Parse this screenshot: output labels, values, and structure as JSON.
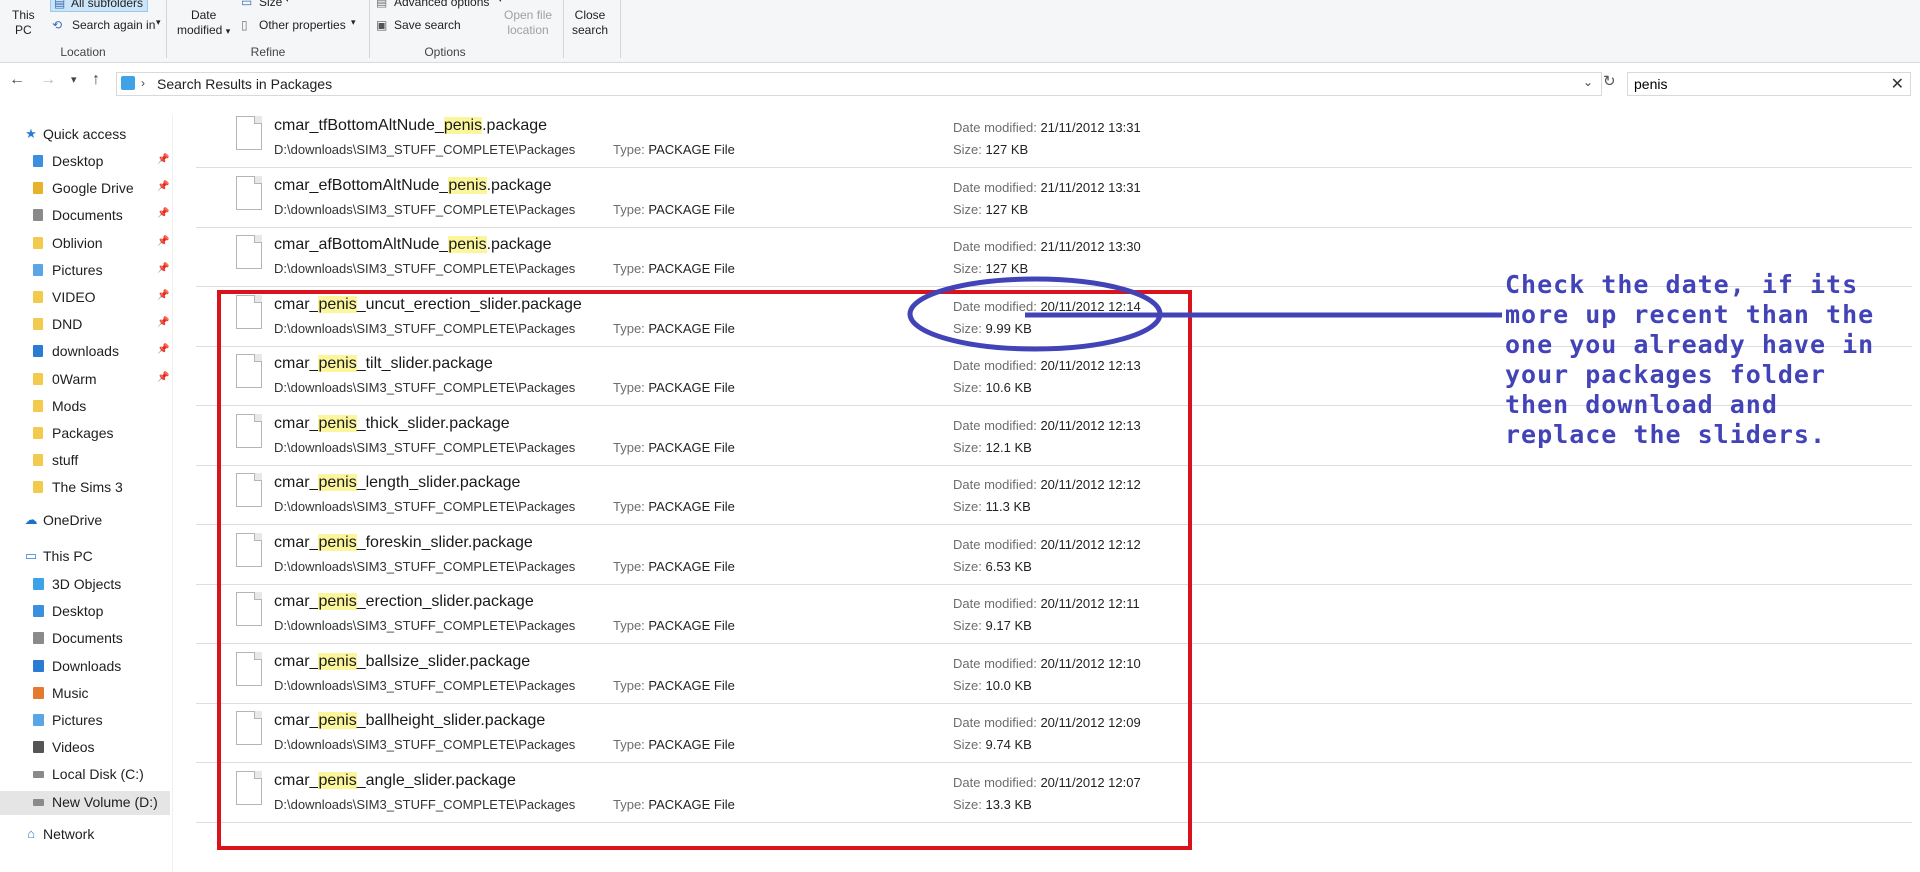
{
  "ribbon": {
    "location": {
      "this_pc_line1": "This",
      "this_pc_line2": "PC",
      "all_subfolders": "All subfolders",
      "search_again_in": "Search again in",
      "group_label": "Location"
    },
    "refine": {
      "date_modified_line1": "Date",
      "date_modified_line2": "modified",
      "size": "Size",
      "other_properties": "Other properties",
      "group_label": "Refine"
    },
    "options": {
      "advanced_options": "Advanced options",
      "save_search": "Save search",
      "open_file_location_line1": "Open file",
      "open_file_location_line2": "location",
      "group_label": "Options"
    },
    "close_search_line1": "Close",
    "close_search_line2": "search"
  },
  "address_bar": {
    "path": "Search Results in Packages",
    "search_value": "penis"
  },
  "sidebar": {
    "quick_access": "Quick access",
    "quick_items": [
      {
        "label": "Desktop",
        "pinned": true
      },
      {
        "label": "Google Drive",
        "pinned": true
      },
      {
        "label": "Documents",
        "pinned": true
      },
      {
        "label": "Oblivion",
        "pinned": true
      },
      {
        "label": "Pictures",
        "pinned": true
      },
      {
        "label": "VIDEO",
        "pinned": true
      },
      {
        "label": "DND",
        "pinned": true
      },
      {
        "label": "downloads",
        "pinned": true
      },
      {
        "label": "0Warm",
        "pinned": true
      },
      {
        "label": "Mods",
        "pinned": false
      },
      {
        "label": "Packages",
        "pinned": false
      },
      {
        "label": "stuff",
        "pinned": false
      },
      {
        "label": "The Sims 3",
        "pinned": false
      }
    ],
    "onedrive": "OneDrive",
    "this_pc": "This PC",
    "pc_items": [
      {
        "label": "3D Objects"
      },
      {
        "label": "Desktop"
      },
      {
        "label": "Documents"
      },
      {
        "label": "Downloads"
      },
      {
        "label": "Music"
      },
      {
        "label": "Pictures"
      },
      {
        "label": "Videos"
      },
      {
        "label": "Local Disk (C:)"
      },
      {
        "label": "New Volume (D:)"
      }
    ],
    "network": "Network"
  },
  "labels": {
    "type_key": "Type:",
    "date_key": "Date modified:",
    "size_key": "Size:"
  },
  "files": [
    {
      "pre": "cmar_tfBottomAltNude_",
      "hl": "penis",
      "post": ".package",
      "path": "D:\\downloads\\SIM3_STUFF_COMPLETE\\Packages",
      "type": "PACKAGE File",
      "date": "21/11/2012 13:31",
      "size": "127 KB"
    },
    {
      "pre": "cmar_efBottomAltNude_",
      "hl": "penis",
      "post": ".package",
      "path": "D:\\downloads\\SIM3_STUFF_COMPLETE\\Packages",
      "type": "PACKAGE File",
      "date": "21/11/2012 13:31",
      "size": "127 KB"
    },
    {
      "pre": "cmar_afBottomAltNude_",
      "hl": "penis",
      "post": ".package",
      "path": "D:\\downloads\\SIM3_STUFF_COMPLETE\\Packages",
      "type": "PACKAGE File",
      "date": "21/11/2012 13:30",
      "size": "127 KB"
    },
    {
      "pre": "cmar_",
      "hl": "penis",
      "post": "_uncut_erection_slider.package",
      "path": "D:\\downloads\\SIM3_STUFF_COMPLETE\\Packages",
      "type": "PACKAGE File",
      "date": "20/11/2012 12:14",
      "size": "9.99 KB"
    },
    {
      "pre": "cmar_",
      "hl": "penis",
      "post": "_tilt_slider.package",
      "path": "D:\\downloads\\SIM3_STUFF_COMPLETE\\Packages",
      "type": "PACKAGE File",
      "date": "20/11/2012 12:13",
      "size": "10.6 KB"
    },
    {
      "pre": "cmar_",
      "hl": "penis",
      "post": "_thick_slider.package",
      "path": "D:\\downloads\\SIM3_STUFF_COMPLETE\\Packages",
      "type": "PACKAGE File",
      "date": "20/11/2012 12:13",
      "size": "12.1 KB"
    },
    {
      "pre": "cmar_",
      "hl": "penis",
      "post": "_length_slider.package",
      "path": "D:\\downloads\\SIM3_STUFF_COMPLETE\\Packages",
      "type": "PACKAGE File",
      "date": "20/11/2012 12:12",
      "size": "11.3 KB"
    },
    {
      "pre": "cmar_",
      "hl": "penis",
      "post": "_foreskin_slider.package",
      "path": "D:\\downloads\\SIM3_STUFF_COMPLETE\\Packages",
      "type": "PACKAGE File",
      "date": "20/11/2012 12:12",
      "size": "6.53 KB"
    },
    {
      "pre": "cmar_",
      "hl": "penis",
      "post": "_erection_slider.package",
      "path": "D:\\downloads\\SIM3_STUFF_COMPLETE\\Packages",
      "type": "PACKAGE File",
      "date": "20/11/2012 12:11",
      "size": "9.17 KB"
    },
    {
      "pre": "cmar_",
      "hl": "penis",
      "post": "_ballsize_slider.package",
      "path": "D:\\downloads\\SIM3_STUFF_COMPLETE\\Packages",
      "type": "PACKAGE File",
      "date": "20/11/2012 12:10",
      "size": "10.0 KB"
    },
    {
      "pre": "cmar_",
      "hl": "penis",
      "post": "_ballheight_slider.package",
      "path": "D:\\downloads\\SIM3_STUFF_COMPLETE\\Packages",
      "type": "PACKAGE File",
      "date": "20/11/2012 12:09",
      "size": "9.74 KB"
    },
    {
      "pre": "cmar_",
      "hl": "penis",
      "post": "_angle_slider.package",
      "path": "D:\\downloads\\SIM3_STUFF_COMPLETE\\Packages",
      "type": "PACKAGE File",
      "date": "20/11/2012 12:07",
      "size": "13.3 KB"
    }
  ],
  "annotation": {
    "lines": [
      "Check the date, if its",
      "more up recent than the",
      "one you already have in",
      "your packages folder",
      "then download and",
      "replace the sliders."
    ],
    "color": "#4343b8",
    "box_color": "#d9131b"
  }
}
